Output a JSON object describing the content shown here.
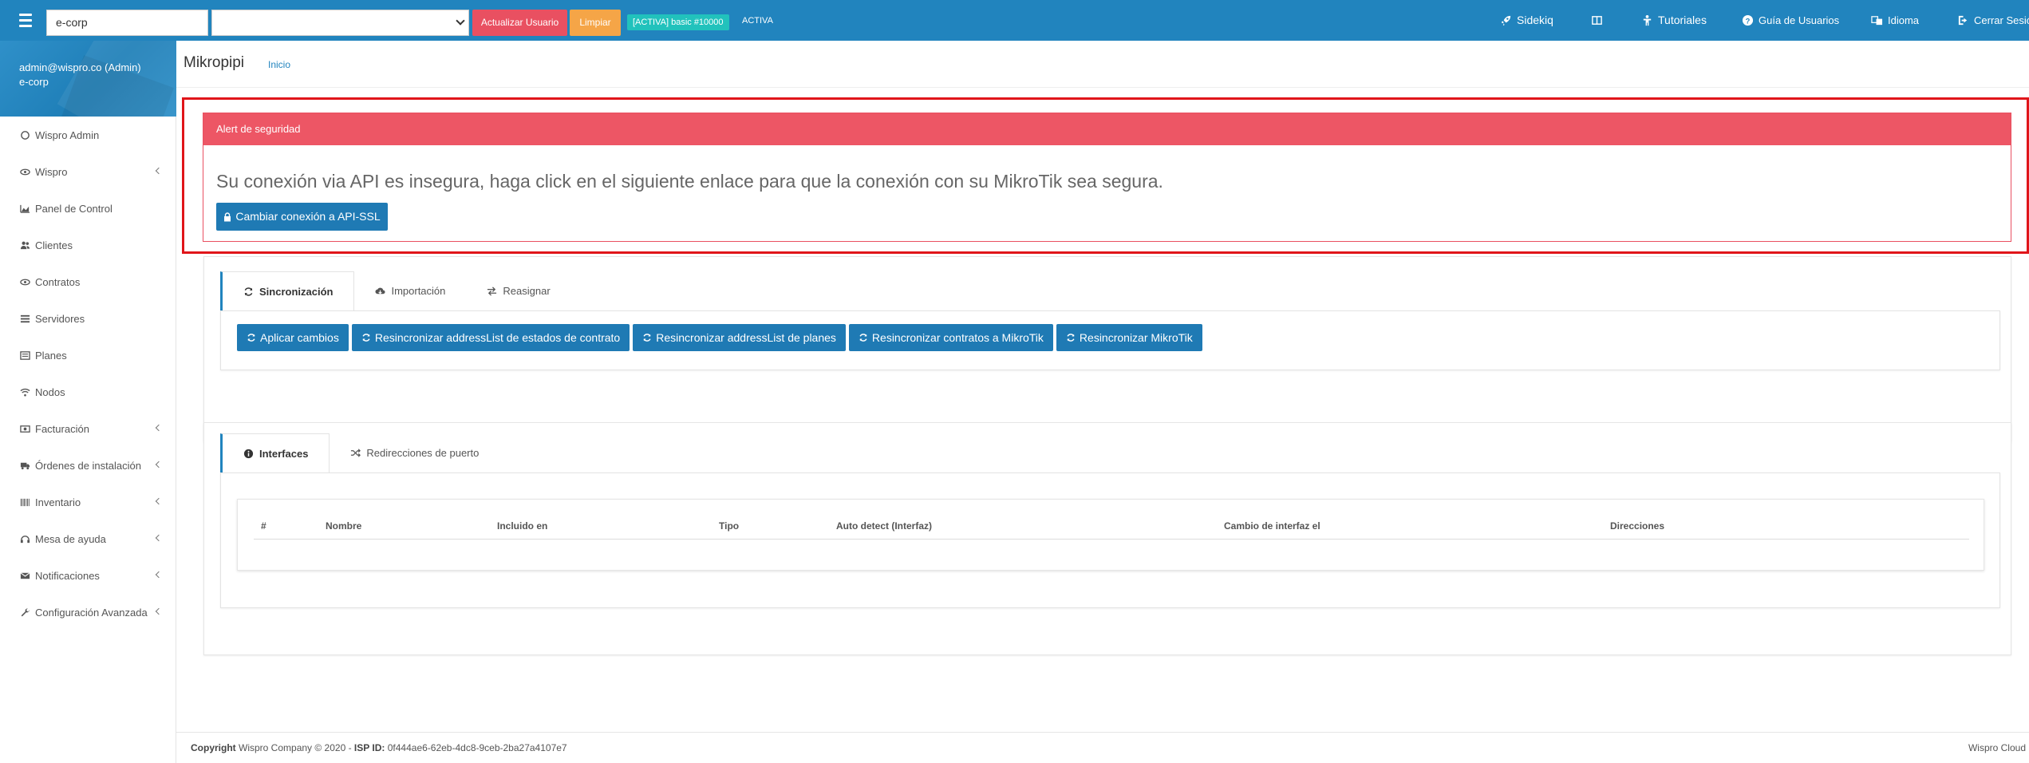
{
  "topbar": {
    "isp_value": "e-corp",
    "btn_update_user": "Actualizar Usuario",
    "btn_clear": "Limpiar",
    "plan_badge": "[ACTIVA] basic #10000",
    "status": "ACTIVA",
    "nav": {
      "sidekiq": "Sidekiq",
      "tutorials": "Tutoriales",
      "user_guide": "Guía de Usuarios",
      "language": "Idioma",
      "logout": "Cerrar Sesió"
    },
    "color": "#2184be"
  },
  "sidebar": {
    "user_email": "admin@wispro.co (Admin)",
    "user_company": "e-corp",
    "items": [
      {
        "label": "Wispro Admin",
        "icon": "circle-icon"
      },
      {
        "label": "Wispro",
        "icon": "eye-icon"
      },
      {
        "label": "Panel de Control",
        "icon": "area-chart-icon"
      },
      {
        "label": "Clientes",
        "icon": "users-icon"
      },
      {
        "label": "Contratos",
        "icon": "handshake-icon"
      },
      {
        "label": "Servidores",
        "icon": "server-icon"
      },
      {
        "label": "Planes",
        "icon": "list-icon"
      },
      {
        "label": "Nodos",
        "icon": "wifi-icon"
      },
      {
        "label": "Facturación",
        "icon": "money-icon"
      },
      {
        "label": "Órdenes de instalación",
        "icon": "truck-icon"
      },
      {
        "label": "Inventario",
        "icon": "barcode-icon"
      },
      {
        "label": "Mesa de ayuda",
        "icon": "headset-icon"
      },
      {
        "label": "Notificaciones",
        "icon": "envelope-icon"
      },
      {
        "label": "Configuración Avanzada",
        "icon": "wrench-icon"
      }
    ]
  },
  "page": {
    "title": "Mikropipi",
    "breadcrumb": "Inicio"
  },
  "alert": {
    "title": "Alert de seguridad",
    "message": "Su conexión via API es insegura, haga click en el siguiente enlace para que la conexión con su MikroTik sea segura.",
    "button": "Cambiar conexión a API-SSL",
    "color": "#ed5665"
  },
  "sync_card": {
    "tabs": [
      "Sincronización",
      "Importación",
      "Reasignar"
    ],
    "actions": [
      "Aplicar cambios",
      "Resincronizar addressList de estados de contrato",
      "Resincronizar addressList de planes",
      "Resincronizar contratos a MikroTik",
      "Resincronizar MikroTik"
    ]
  },
  "interfaces_card": {
    "tabs": [
      "Interfaces",
      "Redirecciones de puerto"
    ],
    "columns": [
      "#",
      "Nombre",
      "Incluido en",
      "Tipo",
      "Auto detect (Interfaz)",
      "Cambio de interfaz el",
      "Direcciones"
    ],
    "rows": []
  },
  "footer": {
    "copyright_label": "Copyright",
    "copyright_text": "Wispro Company © 2020 -",
    "isp_label": "ISP ID:",
    "isp_id": "0f444ae6-62eb-4dc8-9ceb-2ba27a4107e7",
    "right": "Wispro Cloud"
  }
}
